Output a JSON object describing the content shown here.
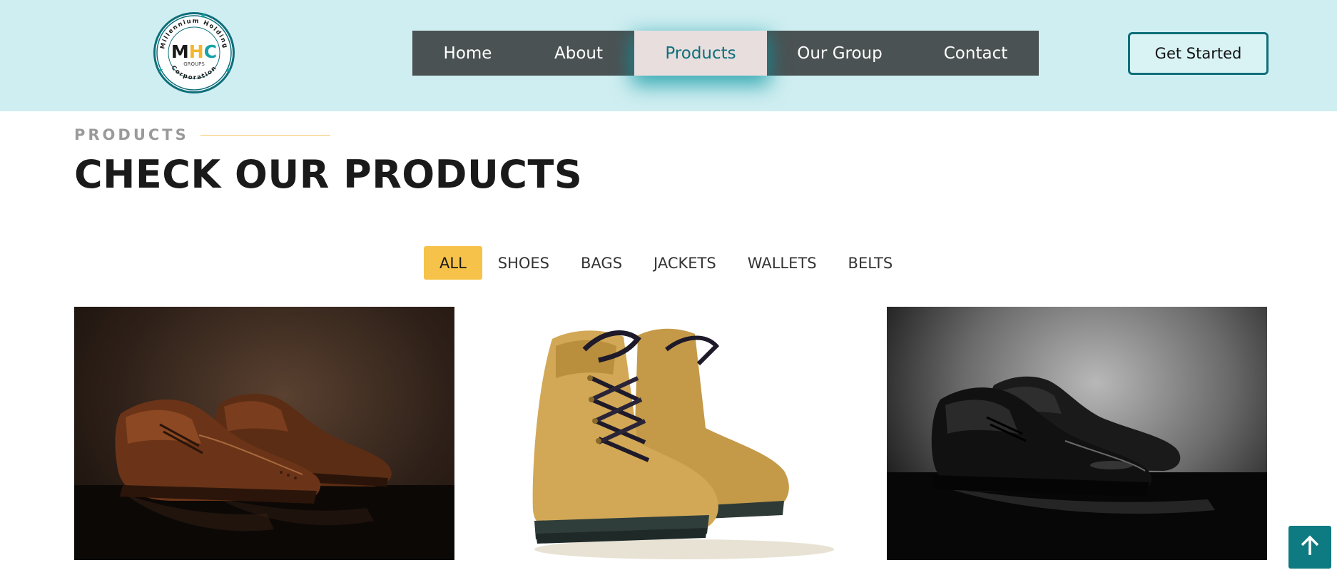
{
  "header": {
    "logo": {
      "ring_text_top": "Millennium Holding",
      "ring_text_bottom": "Corporation",
      "initials": "MHC",
      "sub": "GROUPS"
    },
    "nav": [
      {
        "label": "Home",
        "active": false
      },
      {
        "label": "About",
        "active": false
      },
      {
        "label": "Products",
        "active": true
      },
      {
        "label": "Our Group",
        "active": false
      },
      {
        "label": "Contact",
        "active": false
      }
    ],
    "cta_label": "Get Started"
  },
  "section": {
    "eyebrow": "PRODUCTS",
    "title": "CHECK OUR PRODUCTS"
  },
  "filters": [
    {
      "label": "ALL",
      "active": true
    },
    {
      "label": "SHOES",
      "active": false
    },
    {
      "label": "BAGS",
      "active": false
    },
    {
      "label": "JACKETS",
      "active": false
    },
    {
      "label": "WALLETS",
      "active": false
    },
    {
      "label": "BELTS",
      "active": false
    }
  ],
  "products": [
    {
      "image": "brown-brogue-shoes-image"
    },
    {
      "image": "tan-lace-up-boots-image"
    },
    {
      "image": "black-oxford-shoes-image"
    }
  ],
  "icons": {
    "back_to_top": "arrow-up-icon"
  },
  "colors": {
    "header_bg": "#cfeef1",
    "nav_bg": "#4b5253",
    "nav_active_bg": "#e8dede",
    "brand_teal": "#0e6f7a",
    "filter_active_bg": "#f7c24a",
    "eyebrow_line": "#f2c96b"
  }
}
